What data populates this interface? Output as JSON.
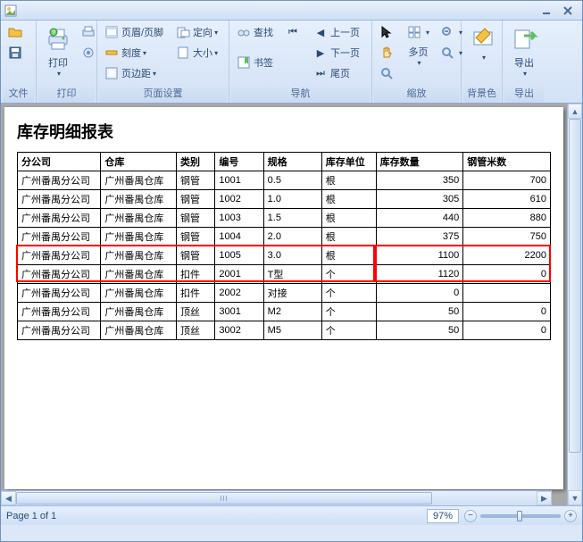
{
  "window": {
    "min": "—",
    "close": "x"
  },
  "ribbon": {
    "file": "文件",
    "print_group": "打印",
    "print": "打印",
    "page_setup_group": "页面设置",
    "header_footer": "页眉/页脚",
    "scale": "刻度",
    "margins": "页边距",
    "orientation": "定向",
    "size": "大小",
    "nav_group": "导航",
    "find": "查找",
    "bookmark": "书签",
    "prev_page": "上一页",
    "next_page": "下一页",
    "last_page": "尾页",
    "nav_label": "导航",
    "zoom_group": "缩放",
    "many_pages": "多页",
    "zoom_label": "缩放",
    "bg_group": "背景色",
    "export": "导出",
    "export_group": "导出"
  },
  "report": {
    "title": "库存明细报表",
    "headers": [
      "分公司",
      "仓库",
      "类别",
      "编号",
      "规格",
      "库存单位",
      "库存数量",
      "钢管米数"
    ],
    "rows": [
      [
        "广州番禺分公司",
        "广州番禺仓库",
        "钢管",
        "1001",
        "0.5",
        "根",
        "350",
        "700"
      ],
      [
        "广州番禺分公司",
        "广州番禺仓库",
        "钢管",
        "1002",
        "1.0",
        "根",
        "305",
        "610"
      ],
      [
        "广州番禺分公司",
        "广州番禺仓库",
        "钢管",
        "1003",
        "1.5",
        "根",
        "440",
        "880"
      ],
      [
        "广州番禺分公司",
        "广州番禺仓库",
        "钢管",
        "1004",
        "2.0",
        "根",
        "375",
        "750"
      ],
      [
        "广州番禺分公司",
        "广州番禺仓库",
        "钢管",
        "1005",
        "3.0",
        "根",
        "1100",
        "2200"
      ],
      [
        "广州番禺分公司",
        "广州番禺仓库",
        "扣件",
        "2001",
        "T型",
        "个",
        "1120",
        "0"
      ],
      [
        "广州番禺分公司",
        "广州番禺仓库",
        "扣件",
        "2002",
        "对接",
        "个",
        "0",
        ""
      ],
      [
        "广州番禺分公司",
        "广州番禺仓库",
        "顶丝",
        "3001",
        "M2",
        "个",
        "50",
        "0"
      ],
      [
        "广州番禺分公司",
        "广州番禺仓库",
        "顶丝",
        "3002",
        "M5",
        "个",
        "50",
        "0"
      ]
    ],
    "highlight_rows": [
      4,
      5
    ],
    "numeric_cols": [
      6,
      7
    ]
  },
  "status": {
    "page": "Page 1 of 1",
    "zoom": "97%"
  }
}
